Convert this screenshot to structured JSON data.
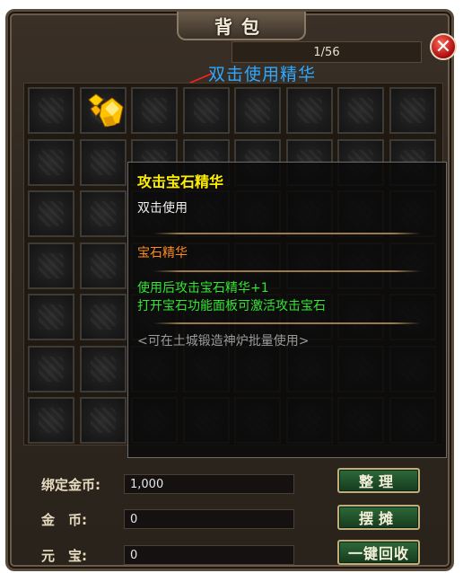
{
  "window": {
    "title": "背包",
    "close_glyph": "✕"
  },
  "capacity": "1/56",
  "annotation": "双击使用精华",
  "grid": {
    "rows": 7,
    "cols": 8,
    "item_slot": {
      "row": 0,
      "col": 1,
      "name": "gem-essence"
    }
  },
  "tooltip": {
    "title": "攻击宝石精华",
    "subtitle": "双击使用",
    "category": "宝石精华",
    "effects": [
      "使用后攻击宝石精华+1",
      "打开宝石功能面板可激活攻击宝石"
    ],
    "note": "<可在土城锻造神炉批量使用>"
  },
  "currency": [
    {
      "label": "绑定金币:",
      "value": "1,000"
    },
    {
      "label": "金　币:",
      "value": "0"
    },
    {
      "label": "元　宝:",
      "value": "0"
    }
  ],
  "buttons": {
    "sort": "整理",
    "stall": "摆摊",
    "recycle": "一键回收"
  },
  "colors": {
    "annotation": "#2ea8ff",
    "tooltip_title": "#ffee00",
    "tooltip_effect": "#32e632",
    "tooltip_category": "#ff8a1e"
  }
}
